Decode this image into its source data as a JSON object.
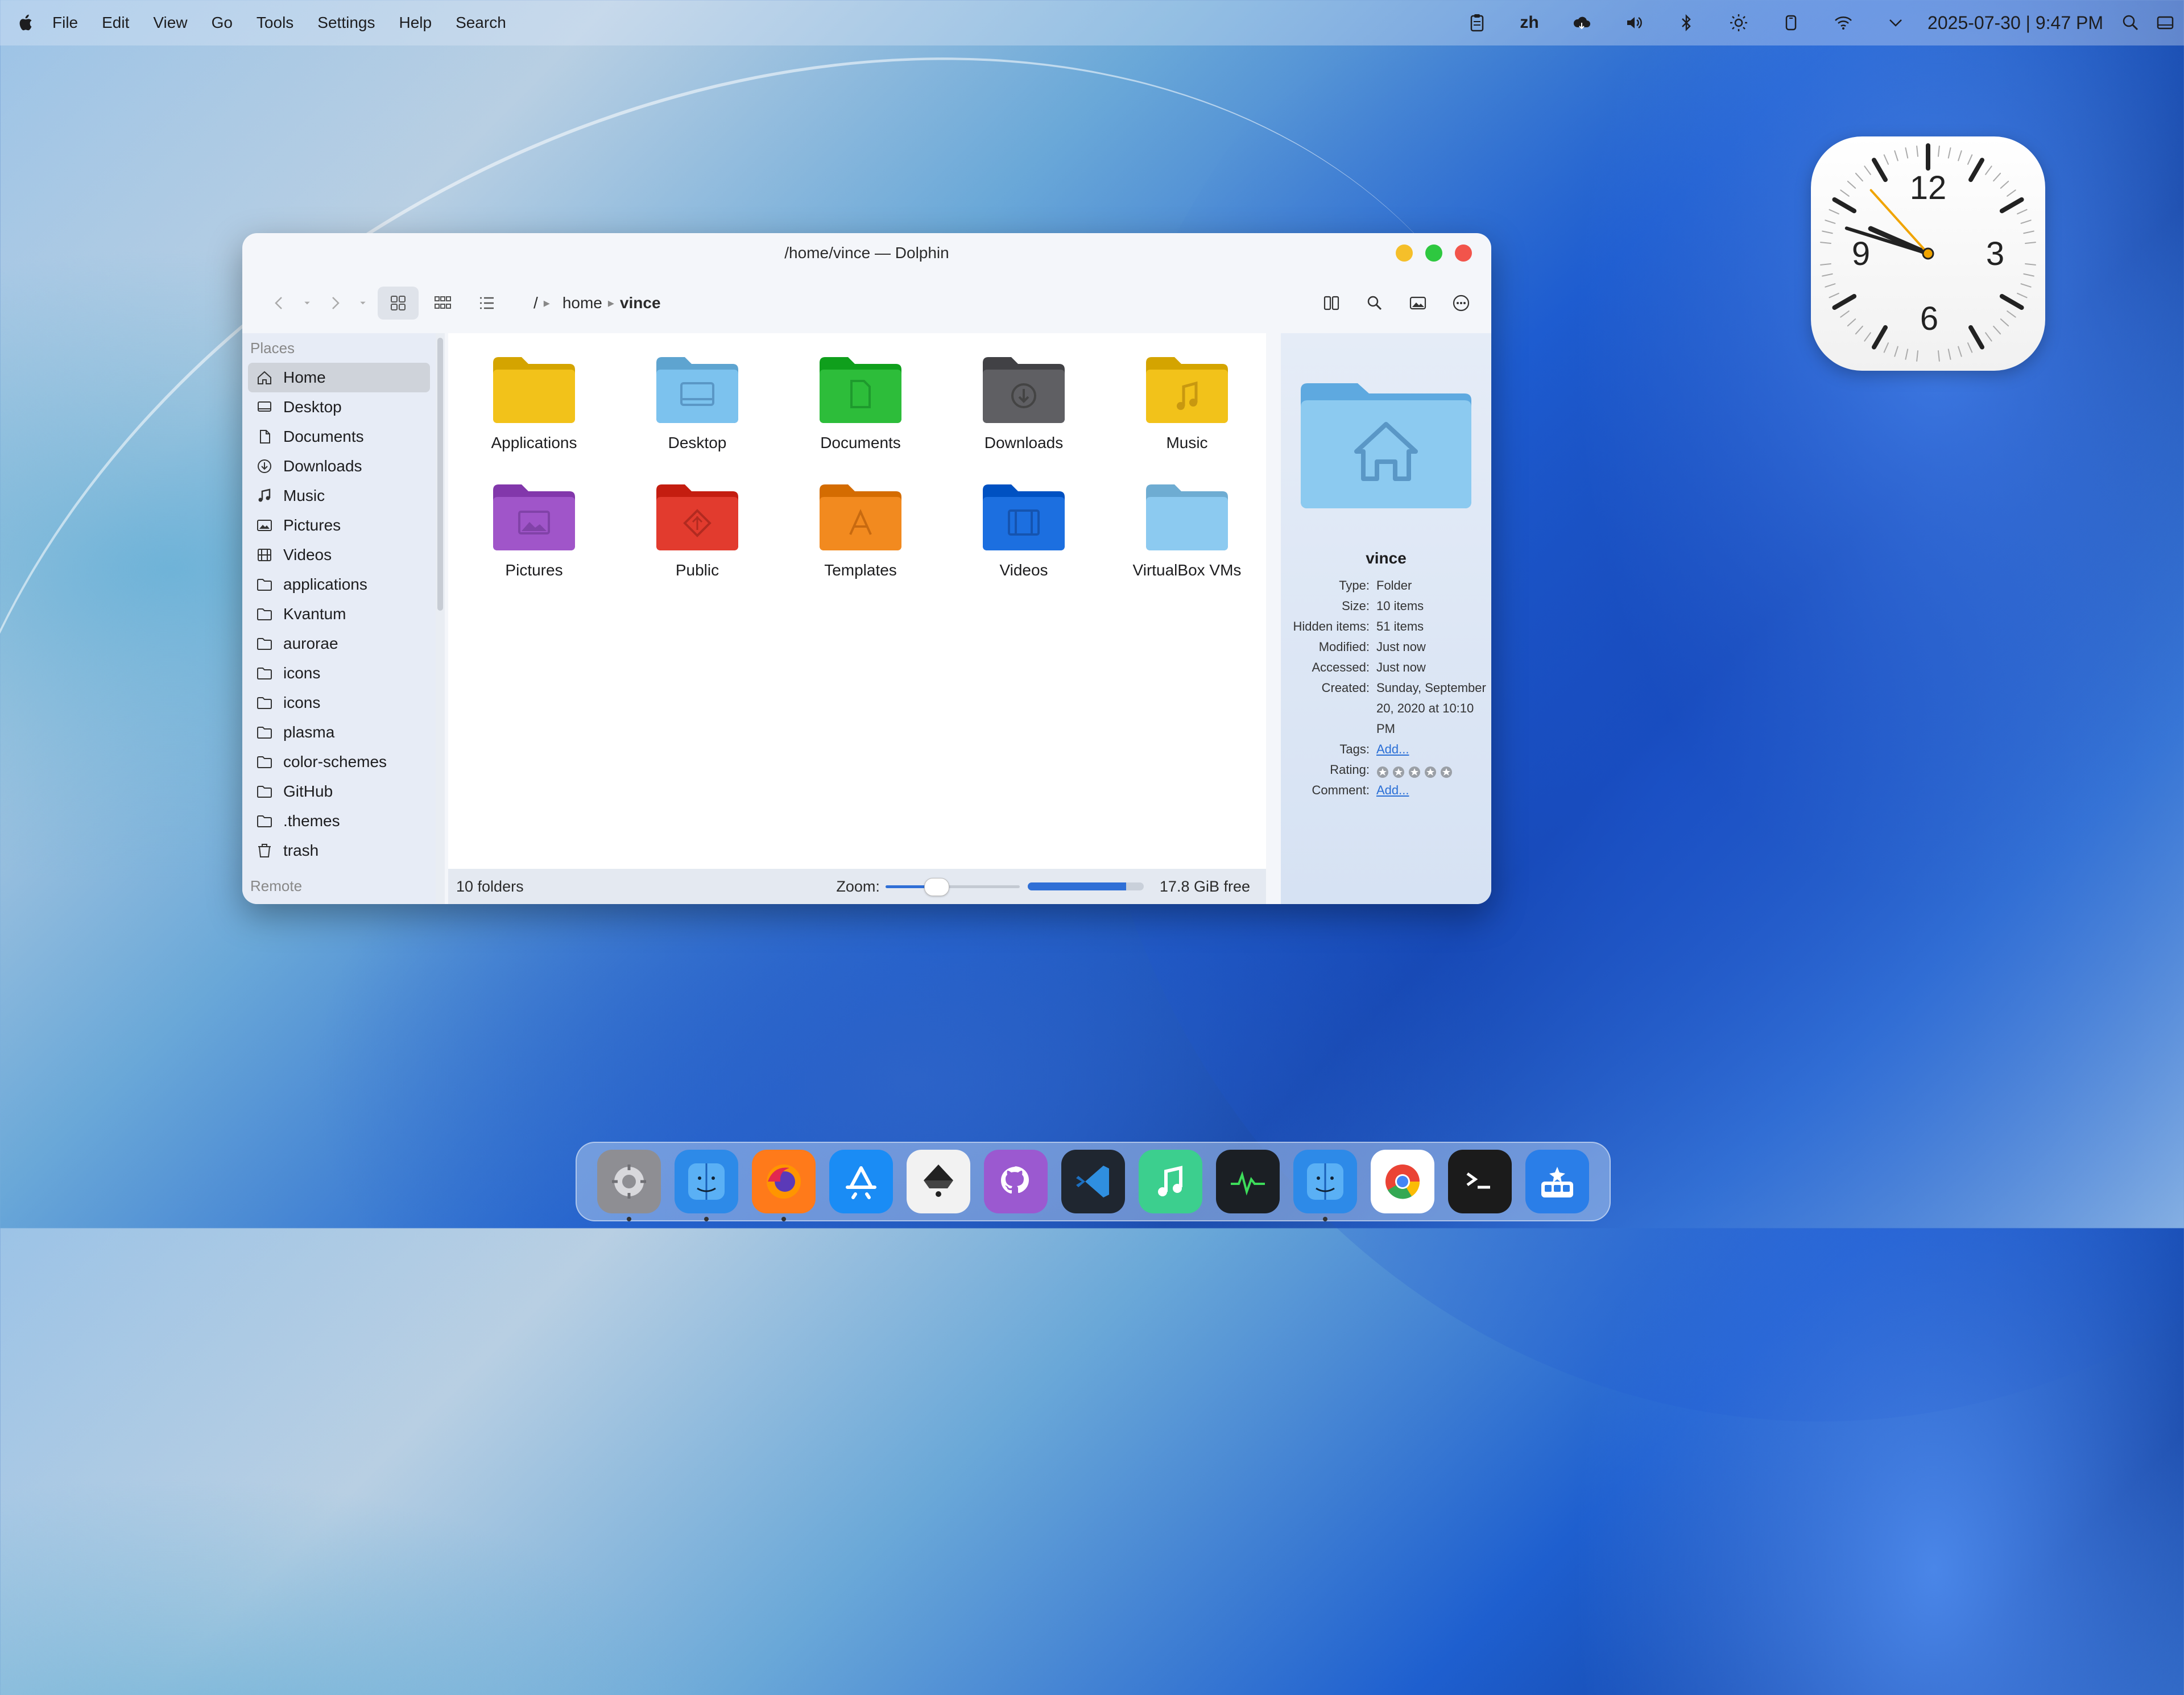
{
  "menubar": {
    "items": [
      "File",
      "Edit",
      "View",
      "Go",
      "Tools",
      "Settings",
      "Help",
      "Search"
    ],
    "input_method": "zh",
    "datetime": "2025-07-30 | 9:47 PM"
  },
  "clock_widget": {
    "numerals": {
      "twelve": "12",
      "three": "3",
      "six": "6",
      "nine": "9"
    },
    "time": {
      "hour": 9,
      "minute": 47,
      "second": 53
    }
  },
  "window": {
    "title": "/home/vince — Dolphin",
    "breadcrumb": {
      "root": "/",
      "home": "home",
      "current": "vince"
    }
  },
  "sidebar": {
    "places_heading": "Places",
    "items": [
      {
        "label": "Home",
        "icon": "home-icon"
      },
      {
        "label": "Desktop",
        "icon": "desktop-icon"
      },
      {
        "label": "Documents",
        "icon": "document-icon"
      },
      {
        "label": "Downloads",
        "icon": "download-icon"
      },
      {
        "label": "Music",
        "icon": "music-note-icon"
      },
      {
        "label": "Pictures",
        "icon": "picture-icon"
      },
      {
        "label": "Videos",
        "icon": "film-icon"
      },
      {
        "label": "applications",
        "icon": "folder-icon"
      },
      {
        "label": "Kvantum",
        "icon": "folder-icon"
      },
      {
        "label": "aurorae",
        "icon": "folder-icon"
      },
      {
        "label": "icons",
        "icon": "folder-icon"
      },
      {
        "label": "icons",
        "icon": "folder-icon"
      },
      {
        "label": "plasma",
        "icon": "folder-icon"
      },
      {
        "label": "color-schemes",
        "icon": "folder-icon"
      },
      {
        "label": "GitHub",
        "icon": "folder-icon"
      },
      {
        "label": ".themes",
        "icon": "folder-icon"
      },
      {
        "label": "trash",
        "icon": "trash-icon"
      }
    ],
    "remote_heading": "Remote"
  },
  "folders": [
    {
      "label": "Applications",
      "color": "#f2c21a"
    },
    {
      "label": "Desktop",
      "color": "#7cc2ee"
    },
    {
      "label": "Documents",
      "color": "#2dbd3a"
    },
    {
      "label": "Downloads",
      "color": "#5f5f63"
    },
    {
      "label": "Music",
      "color": "#f2c21a"
    },
    {
      "label": "Pictures",
      "color": "#a055c9"
    },
    {
      "label": "Public",
      "color": "#e23b2e"
    },
    {
      "label": "Templates",
      "color": "#f28a1f"
    },
    {
      "label": "Videos",
      "color": "#1c6fe0"
    },
    {
      "label": "VirtualBox VMs",
      "color": "#8ccaf0"
    }
  ],
  "statusbar": {
    "summary": "10 folders",
    "zoom_label": "Zoom:",
    "zoom_level": 0.35,
    "disk_used": 0.85,
    "free_space": "17.8 GiB free"
  },
  "info_panel": {
    "name": "vince",
    "rows": [
      {
        "key": "Type:",
        "value": "Folder"
      },
      {
        "key": "Size:",
        "value": "10 items"
      },
      {
        "key": "Hidden items:",
        "value": "51 items"
      },
      {
        "key": "Modified:",
        "value": "Just now"
      },
      {
        "key": "Accessed:",
        "value": "Just now"
      },
      {
        "key": "Created:",
        "value": "Sunday, September 20, 2020 at 10:10 PM"
      }
    ],
    "tags_key": "Tags:",
    "tags_link": "Add...",
    "rating_key": "Rating:",
    "rating_value": 0,
    "comment_key": "Comment:",
    "comment_link": "Add..."
  },
  "dock": {
    "apps": [
      {
        "name": "system-settings",
        "color": "#8e8e93"
      },
      {
        "name": "finder",
        "color": "#2d8ae8"
      },
      {
        "name": "firefox",
        "color": "#ff7a1a"
      },
      {
        "name": "app-store",
        "color": "#1a8cf5"
      },
      {
        "name": "inkscape",
        "color": "#f2f2f2"
      },
      {
        "name": "github-desktop",
        "color": "#9b59d0"
      },
      {
        "name": "vscode",
        "color": "#1f2630"
      },
      {
        "name": "music",
        "color": "#3ccf8e"
      },
      {
        "name": "activity-monitor",
        "color": "#1b1f24"
      },
      {
        "name": "dolphin",
        "color": "#2d8ae8"
      },
      {
        "name": "chrome",
        "color": "#ffffff"
      },
      {
        "name": "terminal",
        "color": "#1b1b1b"
      },
      {
        "name": "launcher",
        "color": "#2a7ee8"
      }
    ]
  }
}
